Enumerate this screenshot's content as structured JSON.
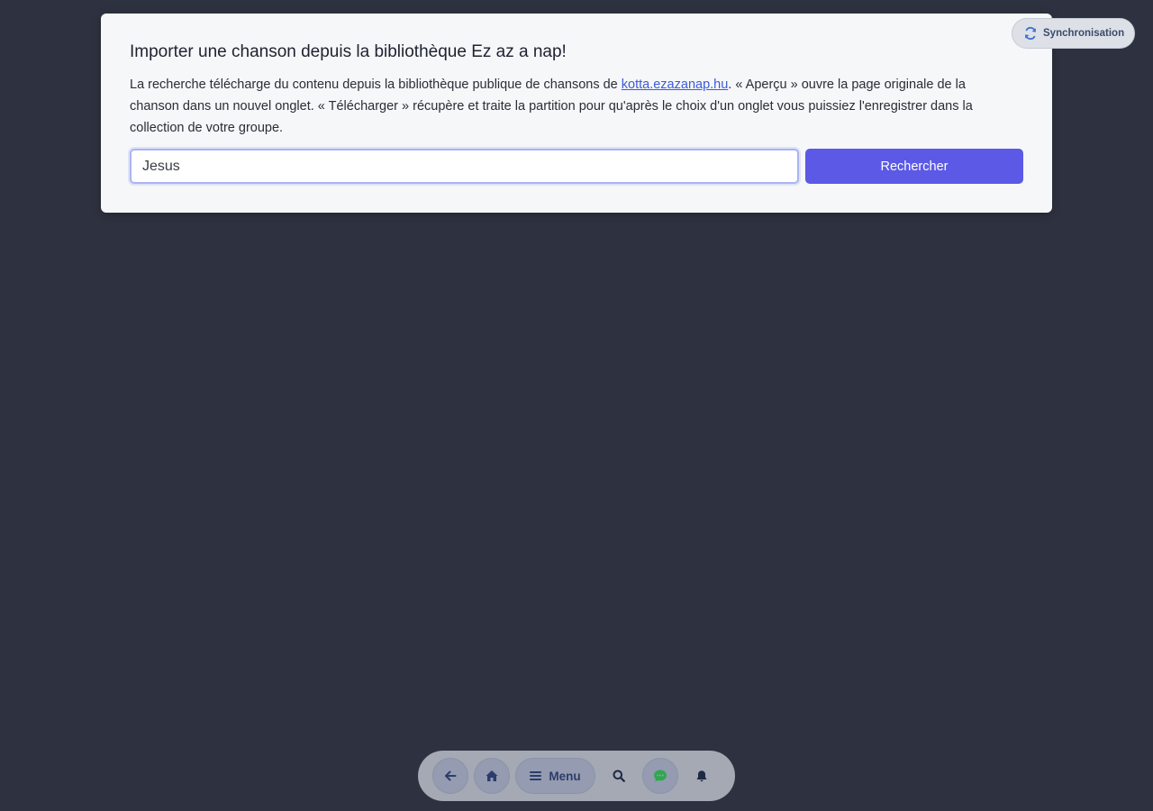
{
  "dialog": {
    "title": "Importer une chanson depuis la bibliothèque Ez az a nap!",
    "desc_before_link": "La recherche télécharge du contenu depuis la bibliothèque publique de chansons de ",
    "link_text": "kotta.ezazanap.hu",
    "desc_after_link": ". « Aperçu » ouvre la page originale de la chanson dans un nouvel onglet. « Télécharger » récupère et traite la partition pour qu'après le choix d'un onglet vous puissiez l'enregistrer dans la collection de votre groupe.",
    "search_value": "Jesus",
    "search_button_label": "Rechercher"
  },
  "sync": {
    "label": "Synchronisation",
    "icon": "sync-icon"
  },
  "bottom_nav": {
    "items": [
      {
        "icon": "arrow-left-icon"
      },
      {
        "icon": "home-icon"
      },
      {
        "icon": "hamburger-icon",
        "label": "Menu"
      },
      {
        "icon": "search-icon"
      },
      {
        "icon": "chat-icon"
      },
      {
        "icon": "bell-icon"
      }
    ]
  },
  "colors": {
    "background": "#2e3240",
    "dialog_bg": "#f6f7f9",
    "accent": "#5b59e6",
    "link": "#3b5bdb",
    "chat_green": "#2fa84f"
  }
}
